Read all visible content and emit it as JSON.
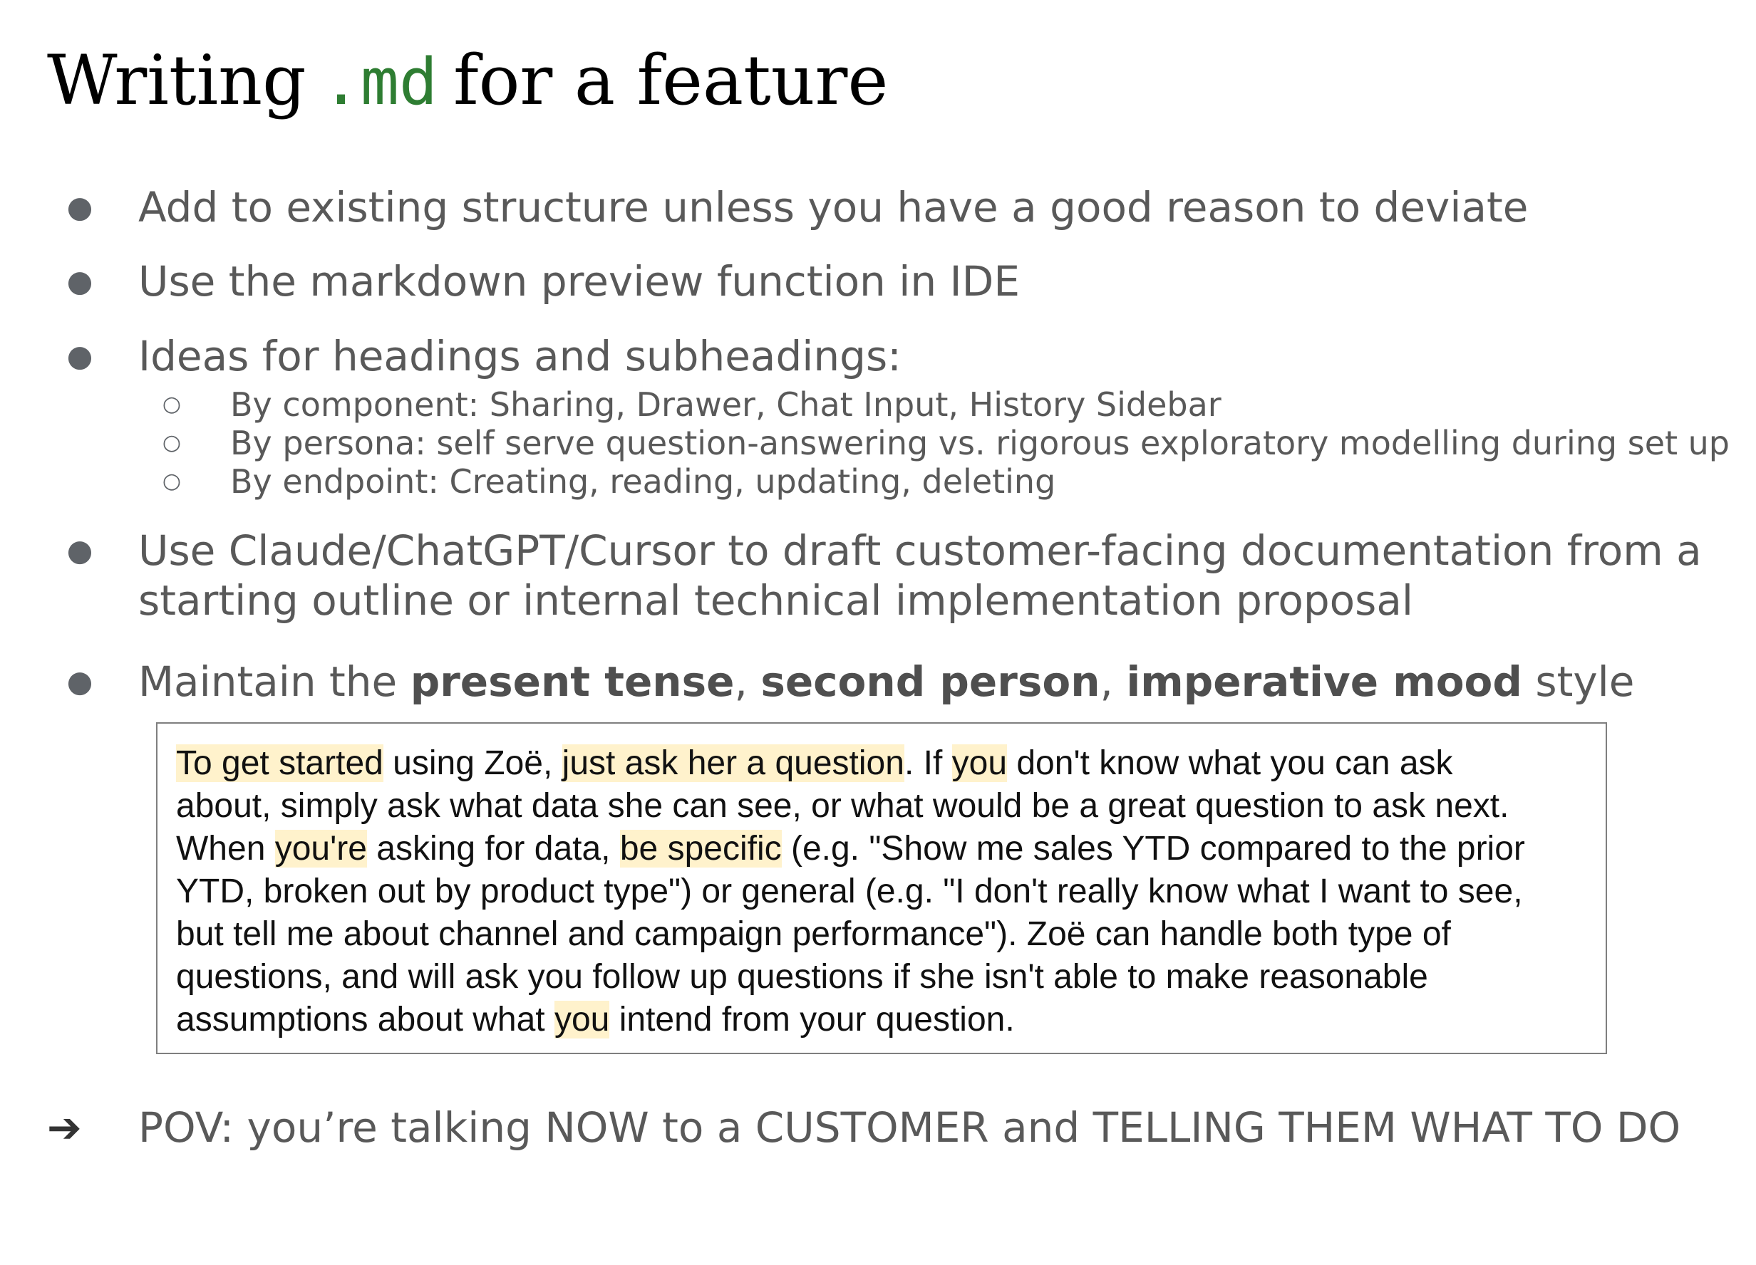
{
  "title": {
    "prefix": "Writing",
    "code": ".md",
    "suffix": "for a feature"
  },
  "bullets": [
    {
      "text": "Add to existing structure unless you have a good reason to deviate"
    },
    {
      "text": "Use the markdown preview function in IDE"
    },
    {
      "text": "Ideas for headings and subheadings:",
      "sub_items": [
        "By component: Sharing, Drawer, Chat Input, History Sidebar",
        "By persona: self serve question-answering vs. rigorous exploratory modelling during set up",
        "By endpoint: Creating, reading, updating, deleting"
      ]
    },
    {
      "text": "Use Claude/ChatGPT/Cursor to draft customer-facing documentation from a starting outline or internal technical implementation proposal"
    },
    {
      "parts": {
        "pre": "Maintain the ",
        "b1": "present tense",
        "sep1": ", ",
        "b2": "second person",
        "sep2": ", ",
        "b3": "imperative mood",
        "post": " style"
      }
    }
  ],
  "example": {
    "l1_hl1": "To get started",
    "l1_t1": " using Zoë, ",
    "l1_hl2": "just ask her a question",
    "l1_t2": ". If ",
    "l1_hl3": "you",
    "l1_t3": " don't know what you can ask",
    "l2": "about, simply ask what data she can see, or what would be a great question to ask next.",
    "l3_t1": "When ",
    "l3_hl1": "you're",
    "l3_t2": " asking for data, ",
    "l3_hl2": "be specific",
    "l3_t3": " (e.g. \"Show me sales YTD compared to the prior",
    "l4": "YTD, broken out by product type\") or general (e.g. \"I don't really know what I want to see,",
    "l5": "but tell me about channel and campaign performance\"). Zoë can handle both type of",
    "l6": "questions, and will ask you follow up questions if she isn't able to make reasonable",
    "l7_t1": "assumptions about what ",
    "l7_hl1": "you",
    "l7_t2": " intend from your question."
  },
  "pov": {
    "arrow": "➔",
    "text": "POV: you’re talking NOW to a CUSTOMER and TELLING THEM WHAT TO DO"
  },
  "colors": {
    "code_green": "#2e7d32",
    "highlight": "#fff2cc",
    "body_text": "#595959"
  }
}
